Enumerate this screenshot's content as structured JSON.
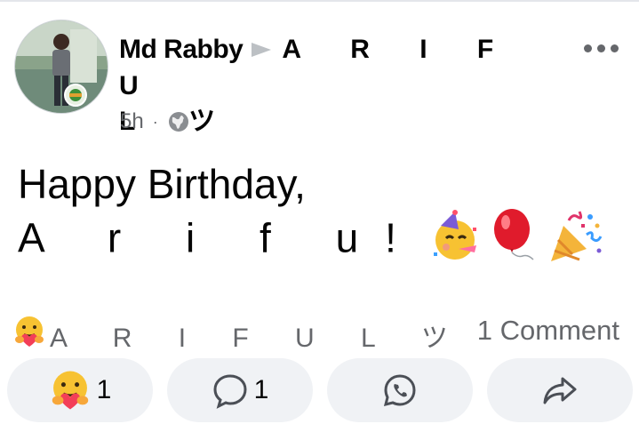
{
  "post": {
    "author": "Md Rabby",
    "target_line1": "A R I F U",
    "target_line2": "L ツ",
    "time": "5h",
    "dot": "·",
    "text_line1": "Happy Birthday,",
    "text_line2": "A r i f u!"
  },
  "reactions": {
    "names": "A R I F U L ツ",
    "comments": "1 Comment"
  },
  "actions": {
    "react_count": "1",
    "comment_count": "1"
  },
  "icons": [
    "avatar",
    "arrow-right-icon",
    "globe-icon",
    "more-icon",
    "partying-face-emoji",
    "balloon-emoji",
    "party-popper-emoji",
    "care-emoji-icon",
    "comment-icon",
    "whatsapp-icon",
    "share-icon"
  ],
  "colors": {
    "muted": "#65676b",
    "pill": "#f0f2f5",
    "text": "#050505"
  }
}
